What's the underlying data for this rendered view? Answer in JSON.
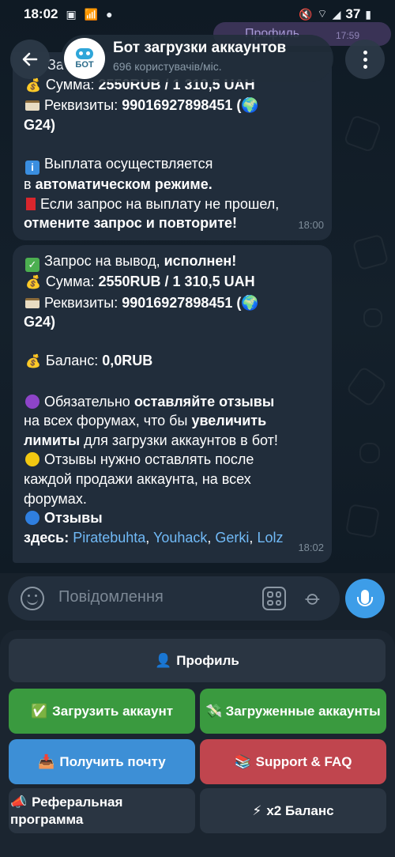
{
  "status_bar": {
    "time": "18:02",
    "battery": "37"
  },
  "header": {
    "avatar_text": "БОТ",
    "title": "Бот загрузки аккаунтов",
    "subtitle": "696 користувачів/міс."
  },
  "ghost": {
    "text": "Профиль",
    "time": "17:59"
  },
  "message1": {
    "partial_top": "За",
    "sum_label": "Сумма: ",
    "sum_value": "2550RUB  / 1 310,5 UAH",
    "req_label": "Реквизиты: ",
    "req_value": "99016927898451 (",
    "req_tail": "G24)",
    "info_line1": "Выплата осуществляется",
    "info_line2_pre": "в ",
    "info_line2_bold": "автоматическом режиме.",
    "warn_line1": "Если запрос на выплату не прошел,",
    "warn_line2_bold": "отмените запрос и повторите!",
    "time": "18:00"
  },
  "message2": {
    "req_pre": "Запрос на вывод, ",
    "req_bold": "исполнен!",
    "sum_label": "Сумма: ",
    "sum_value": "2550RUB  / 1 310,5 UAH",
    "req_label": "Реквизиты: ",
    "req_value": "99016927898451 (",
    "req_tail": "G24)",
    "balance_label": "Баланс: ",
    "balance_value": "0,0RUB",
    "p1_pre": "Обязательно ",
    "p1_bold": "оставляйте отзывы",
    "p1_line2_pre": "на всех форумах, что бы ",
    "p1_line2_bold": "увеличить",
    "p1_line3_bold": "лимиты",
    "p1_line3_post": " для загрузки аккаунтов в бот!",
    "p2_line1": "Отзывы нужно оставлять после",
    "p2_line2": "каждой продажи аккаунта, на всех",
    "p2_line3": "форумах.",
    "p3_bold": "Отзывы",
    "p3_here": "здесь: ",
    "links": [
      "Piratebuhta",
      "Youhack",
      "Gerki",
      "Lolz"
    ],
    "sep": ", ",
    "time": "18:02"
  },
  "input": {
    "placeholder": "Повідомлення"
  },
  "keyboard": {
    "profile": "Профиль",
    "upload": "Загрузить аккаунт",
    "uploaded": "Загруженные аккаунты",
    "mail": "Получить почту",
    "support": "Support & FAQ",
    "referral_line1": "Реферальная",
    "referral_line2": "программа",
    "x2": "x2 Баланс"
  },
  "colors": {
    "bubble": "#212d3b",
    "link": "#71baf7",
    "green_button": "#3a9a3f",
    "blue_button": "#3d8fd6",
    "red_button": "#c0454e",
    "mic": "#3d9de8"
  },
  "icons": [
    "back-arrow-icon",
    "more-vertical-icon",
    "money-bag-icon",
    "credit-card-icon",
    "globe-icon",
    "info-icon",
    "red-square-icon",
    "check-mark-icon",
    "purple-circle-icon",
    "yellow-circle-icon",
    "blue-circle-icon",
    "emoji-icon",
    "keyboard-icon",
    "paperclip-icon",
    "microphone-icon",
    "user-icon",
    "inbox-icon",
    "books-icon",
    "megaphone-icon",
    "lightning-icon",
    "money-stack-icon"
  ]
}
